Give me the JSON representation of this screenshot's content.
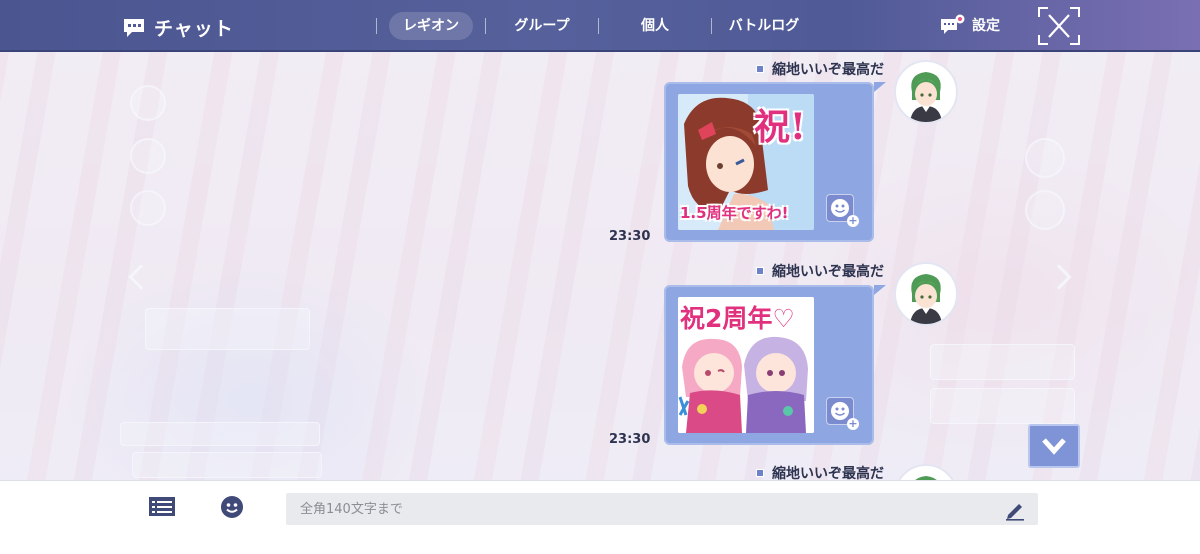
{
  "header": {
    "title": "チャット",
    "tabs": [
      {
        "label": "レギオン",
        "active": true
      },
      {
        "label": "グループ",
        "active": false
      },
      {
        "label": "個人",
        "active": false
      },
      {
        "label": "バトルログ",
        "active": false
      }
    ],
    "settings_label": "設定"
  },
  "messages": [
    {
      "sender": "縮地いいぞ最高だ",
      "time": "23:30",
      "sticker": {
        "headline": "祝!",
        "caption": "1.5周年ですわ!"
      }
    },
    {
      "sender": "縮地いいぞ最高だ",
      "time": "23:30",
      "sticker": {
        "headline": "祝2周年♡",
        "caption": ""
      }
    },
    {
      "sender": "縮地いいぞ最高だ",
      "time": "",
      "sticker": null
    }
  ],
  "composer": {
    "placeholder": "全角140文字まで",
    "value": ""
  },
  "colors": {
    "header": "#4f5a96",
    "bubble": "#8ea6e2",
    "accent": "#7e94d6",
    "sticker_pink": "#e0307e"
  },
  "icons": [
    "chat-icon",
    "settings-chat-icon",
    "close-icon",
    "emoji-react-icon",
    "chevron-down-icon",
    "list-icon",
    "emoji-icon",
    "pencil-icon"
  ]
}
